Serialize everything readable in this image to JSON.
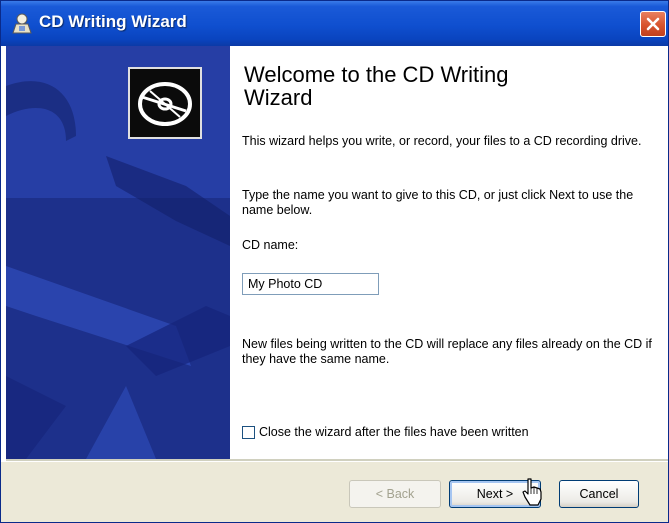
{
  "window": {
    "title": "CD Writing Wizard",
    "app_icon": "cd-writer-icon",
    "close_icon": "close-icon"
  },
  "banner": {
    "icon": "cd-disc-icon",
    "background_color": "#263ea5"
  },
  "content": {
    "heading": "Welcome to the CD Writing Wizard",
    "intro": "This wizard helps you write, or record, your files to a CD recording drive.",
    "instruction": "Type the name you want to give to this CD, or just click Next to use the name below.",
    "cd_name_label": "CD name:",
    "cd_name_value": "My Photo CD",
    "replace_note": "New files being written to the CD will replace any files already on the CD if they have the same name.",
    "close_checkbox_label": "Close the wizard after the files have been written",
    "close_checkbox_checked": false
  },
  "footer": {
    "back_label": "< Back",
    "next_label": "Next >",
    "cancel_label": "Cancel"
  },
  "colors": {
    "titlebar": "#0f4fcf",
    "close_button": "#d8542e",
    "footer_bg": "#ece9d8"
  }
}
